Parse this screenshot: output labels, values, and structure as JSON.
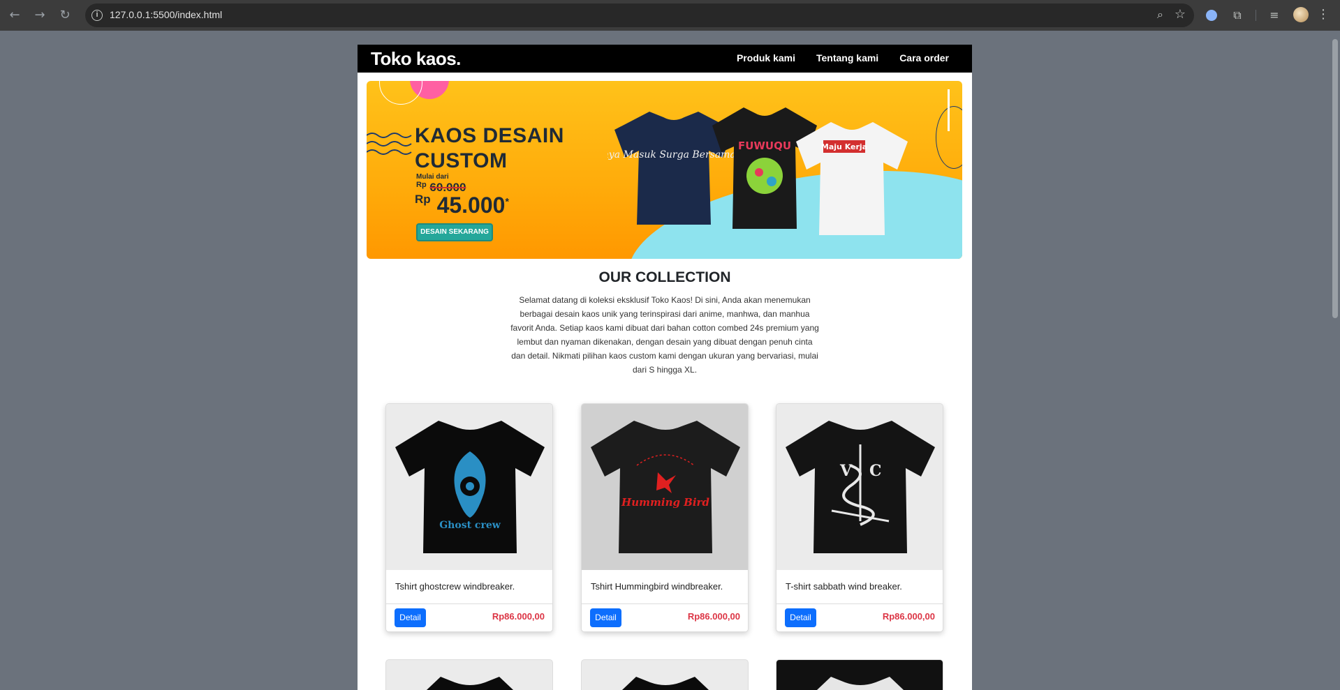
{
  "browser": {
    "url": "127.0.0.1:5500/index.html"
  },
  "site": {
    "brand": "Toko kaos.",
    "nav": [
      "Produk kami",
      "Tentang kami",
      "Cara order"
    ]
  },
  "banner": {
    "title_line1": "KAOS DESAIN",
    "title_line2": "CUSTOM",
    "mulai": "Mulai dari",
    "old_price_rp": "Rp",
    "old_price": "60.000",
    "new_price_rp": "Rp",
    "new_price": "45.000",
    "new_price_mark": "*",
    "cta": "DESAIN SEKARANG",
    "shirt_texts": [
      "Perkuatnya Masuk Surga Bersama Keluarga",
      "FUWUQU",
      "Maju Kerja"
    ]
  },
  "collection": {
    "title": "OUR COLLECTION",
    "description": "Selamat datang di koleksi eksklusif Toko Kaos! Di sini, Anda akan menemukan berbagai desain kaos unik yang terinspirasi dari anime, manhwa, dan manhua favorit Anda. Setiap kaos kami dibuat dari bahan cotton combed 24s premium yang lembut dan nyaman dikenakan, dengan desain yang dibuat dengan penuh cinta dan detail. Nikmati pilihan kaos custom kami dengan ukuran yang bervariasi, mulai dari S hingga XL."
  },
  "products": [
    {
      "name": "Tshirt ghostcrew windbreaker.",
      "price": "Rp86.000,00",
      "button": "Detail",
      "print": "Ghost crew",
      "print_color": "#2a8fc4"
    },
    {
      "name": "Tshirt Hummingbird windbreaker.",
      "price": "Rp86.000,00",
      "button": "Detail",
      "print": "Humming Bird",
      "print_color": "#e02020"
    },
    {
      "name": "T-shirt sabbath wind breaker.",
      "price": "Rp86.000,00",
      "button": "Detail",
      "print": "",
      "print_color": "#e8e8e8"
    }
  ],
  "colors": {
    "accent_blue": "#0d6efd",
    "price_red": "#dc3545",
    "banner_yellow": "#ffb81a",
    "cta_teal": "#25a79a"
  }
}
